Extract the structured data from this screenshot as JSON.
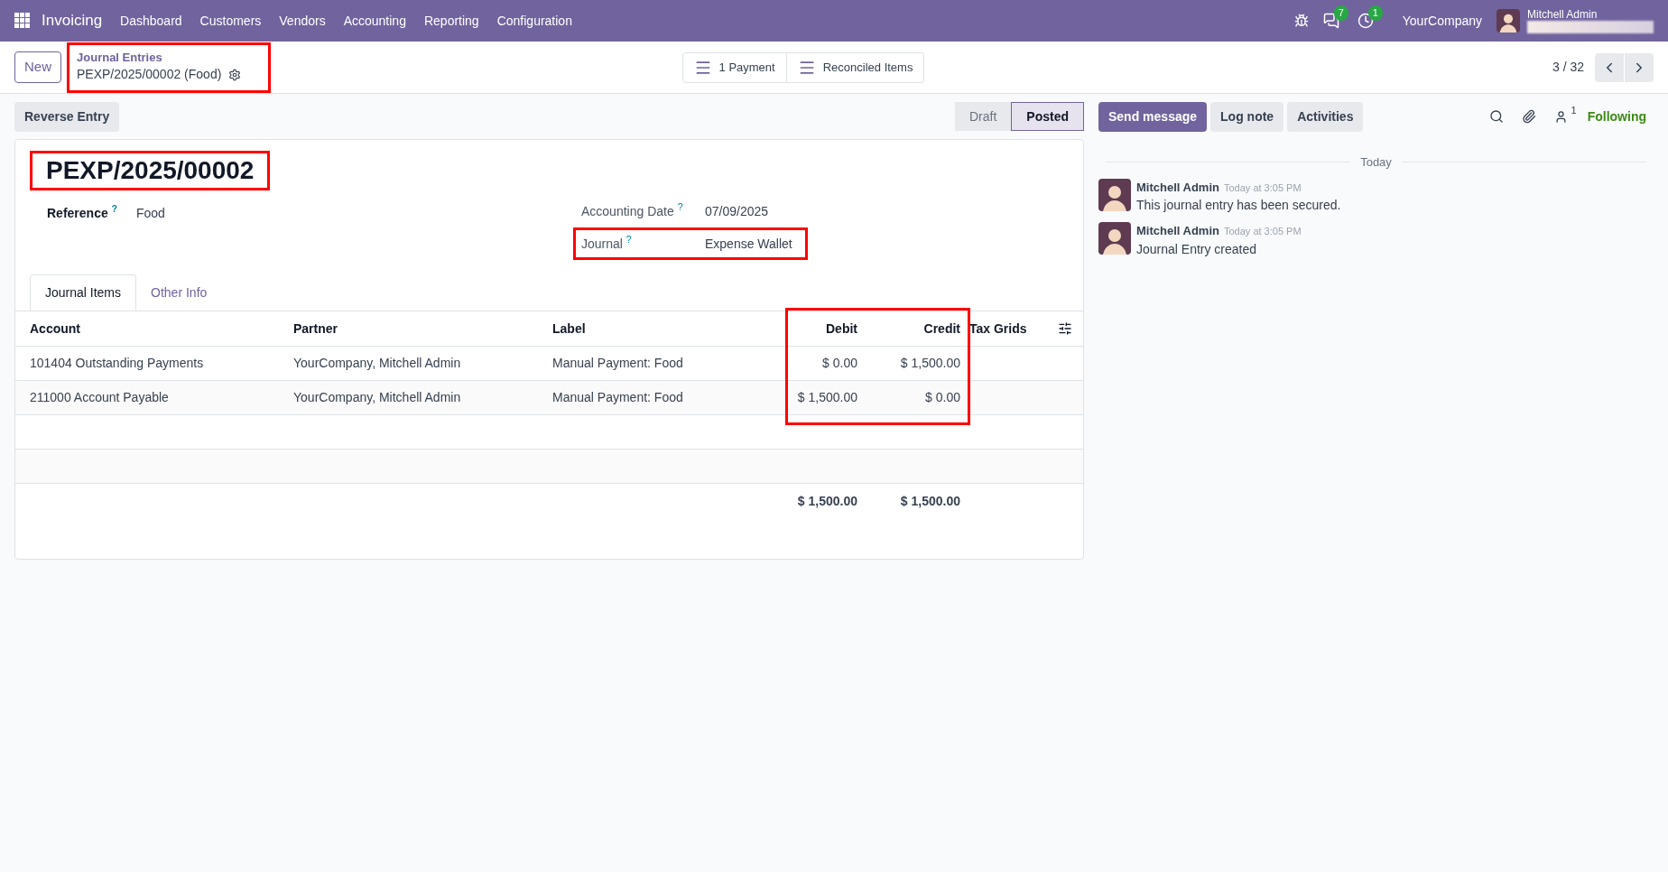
{
  "navbar": {
    "app_name": "Invoicing",
    "menu": [
      "Dashboard",
      "Customers",
      "Vendors",
      "Accounting",
      "Reporting",
      "Configuration"
    ],
    "messages_badge": "7",
    "activities_badge": "1",
    "company": "YourCompany",
    "user": "Mitchell Admin"
  },
  "control_panel": {
    "new_button": "New",
    "breadcrumb": {
      "parent": "Journal Entries",
      "current": "PEXP/2025/00002 (Food)",
      "highlighted": true
    },
    "smart_buttons": [
      "1 Payment",
      "Reconciled Items"
    ],
    "pager": "3 / 32"
  },
  "actions": [
    "Reverse Entry"
  ],
  "stages": [
    {
      "label": "Draft",
      "selected": false
    },
    {
      "label": "Posted",
      "selected": true
    }
  ],
  "form": {
    "title": "PEXP/2025/00002",
    "title_highlighted": true,
    "fields_left": [
      {
        "label": "Reference",
        "help": "?",
        "value": "Food",
        "highlighted": false
      }
    ],
    "fields_right": [
      {
        "label": "Accounting Date",
        "help": "?",
        "value": "07/09/2025",
        "highlighted": false
      },
      {
        "label": "Journal",
        "help": "?",
        "value": "Expense Wallet",
        "highlighted": true
      }
    ],
    "tabs": [
      {
        "label": "Journal Items",
        "selected": true
      },
      {
        "label": "Other Info",
        "selected": false
      }
    ],
    "table": {
      "columns": [
        "Account",
        "Partner",
        "Label",
        "Debit",
        "Credit",
        "Tax Grids"
      ],
      "amounts_highlighted": true,
      "rows": [
        {
          "account": "101404 Outstanding Payments",
          "partner": "YourCompany, Mitchell Admin",
          "label": "Manual Payment: Food",
          "debit": "$ 0.00",
          "credit": "$ 1,500.00"
        },
        {
          "account": "211000 Account Payable",
          "partner": "YourCompany, Mitchell Admin",
          "label": "Manual Payment: Food",
          "debit": "$ 1,500.00",
          "credit": "$ 0.00"
        }
      ],
      "totals": {
        "debit": "$ 1,500.00",
        "credit": "$ 1,500.00"
      }
    }
  },
  "chatter": {
    "buttons": [
      {
        "label": "Send message",
        "selected": true
      },
      {
        "label": "Log note",
        "selected": false
      },
      {
        "label": "Activities",
        "selected": false
      }
    ],
    "followers_count": "1",
    "following": "Following",
    "date_separator": "Today",
    "messages": [
      {
        "author": "Mitchell Admin",
        "time": "Today at 3:05 PM",
        "body": "This journal entry has been secured."
      },
      {
        "author": "Mitchell Admin",
        "time": "Today at 3:05 PM",
        "body": "Journal Entry created"
      }
    ]
  }
}
